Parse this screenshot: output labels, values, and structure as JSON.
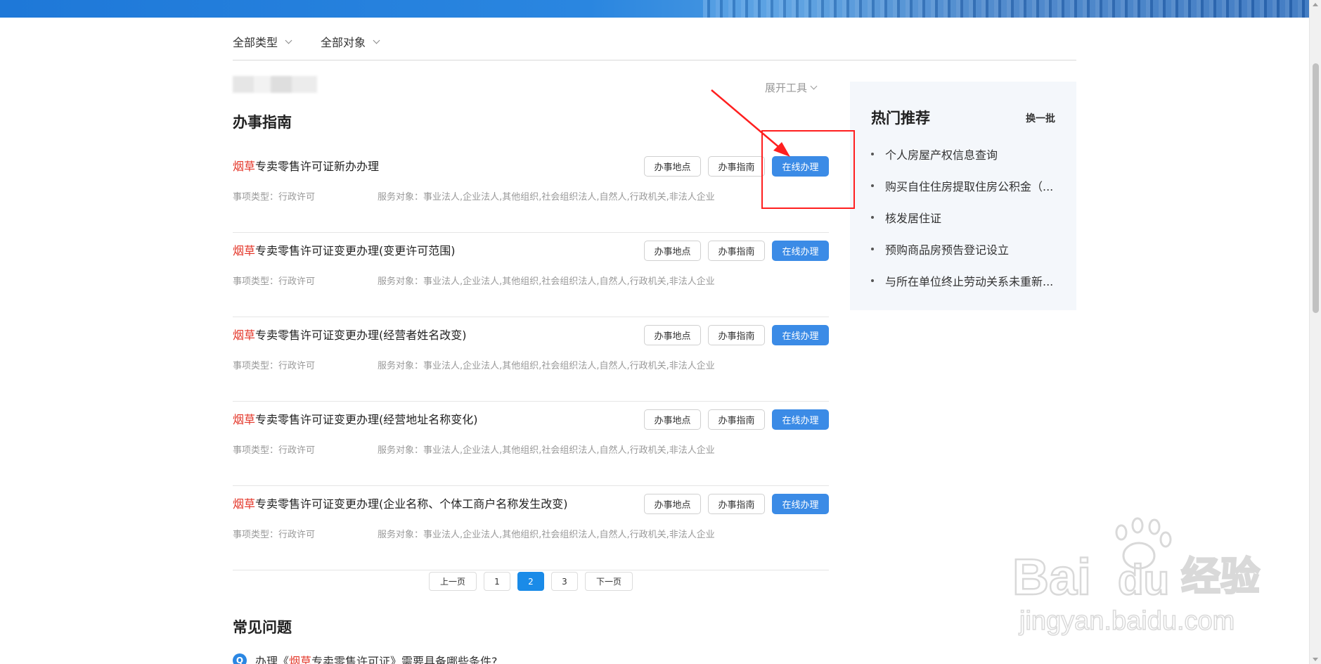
{
  "filters": {
    "type_label": "全部类型",
    "object_label": "全部对象"
  },
  "tools": {
    "expand_label": "展开工具"
  },
  "guide": {
    "title": "办事指南",
    "location_btn": "办事地点",
    "guide_btn": "办事指南",
    "online_btn": "在线办理",
    "items": [
      {
        "highlight": "烟草",
        "rest": "专卖零售许可证新办办理",
        "type": "事项类型：行政许可",
        "object": "服务对象：事业法人,企业法人,其他组织,社会组织法人,自然人,行政机关,非法人企业"
      },
      {
        "highlight": "烟草",
        "rest": "专卖零售许可证变更办理(变更许可范围)",
        "type": "事项类型：行政许可",
        "object": "服务对象：事业法人,企业法人,其他组织,社会组织法人,自然人,行政机关,非法人企业"
      },
      {
        "highlight": "烟草",
        "rest": "专卖零售许可证变更办理(经营者姓名改变)",
        "type": "事项类型：行政许可",
        "object": "服务对象：事业法人,企业法人,其他组织,社会组织法人,自然人,行政机关,非法人企业"
      },
      {
        "highlight": "烟草",
        "rest": "专卖零售许可证变更办理(经营地址名称变化)",
        "type": "事项类型：行政许可",
        "object": "服务对象：事业法人,企业法人,其他组织,社会组织法人,自然人,行政机关,非法人企业"
      },
      {
        "highlight": "烟草",
        "rest": "专卖零售许可证变更办理(企业名称、个体工商户名称发生改变)",
        "type": "事项类型：行政许可",
        "object": "服务对象：事业法人,企业法人,其他组织,社会组织法人,自然人,行政机关,非法人企业"
      }
    ]
  },
  "pagination": {
    "prev": "上一页",
    "pages": [
      "1",
      "2",
      "3"
    ],
    "current": "2",
    "next": "下一页"
  },
  "faq": {
    "title": "常见问题",
    "items": [
      {
        "badge": "Q",
        "pre": "办理《",
        "highlight": "烟草",
        "post": "专卖零售许可证》需要具备哪些条件?"
      }
    ]
  },
  "hot": {
    "title": "热门推荐",
    "refresh": "换一批",
    "items": [
      "个人房屋产权信息查询",
      "购买自住住房提取住房公积金（...",
      "核发居住证",
      "预购商品房预告登记设立",
      "与所在单位终止劳动关系未重新..."
    ]
  },
  "watermark": {
    "line1": "Bai",
    "line1b": "du",
    "cn": "经验",
    "url": "jingyan.baidu.com"
  },
  "colors": {
    "accent": "#3b8be6",
    "highlight_text": "#e4372a",
    "annotation": "#ff1f1f",
    "sidebar_bg": "#f4f7fb"
  }
}
